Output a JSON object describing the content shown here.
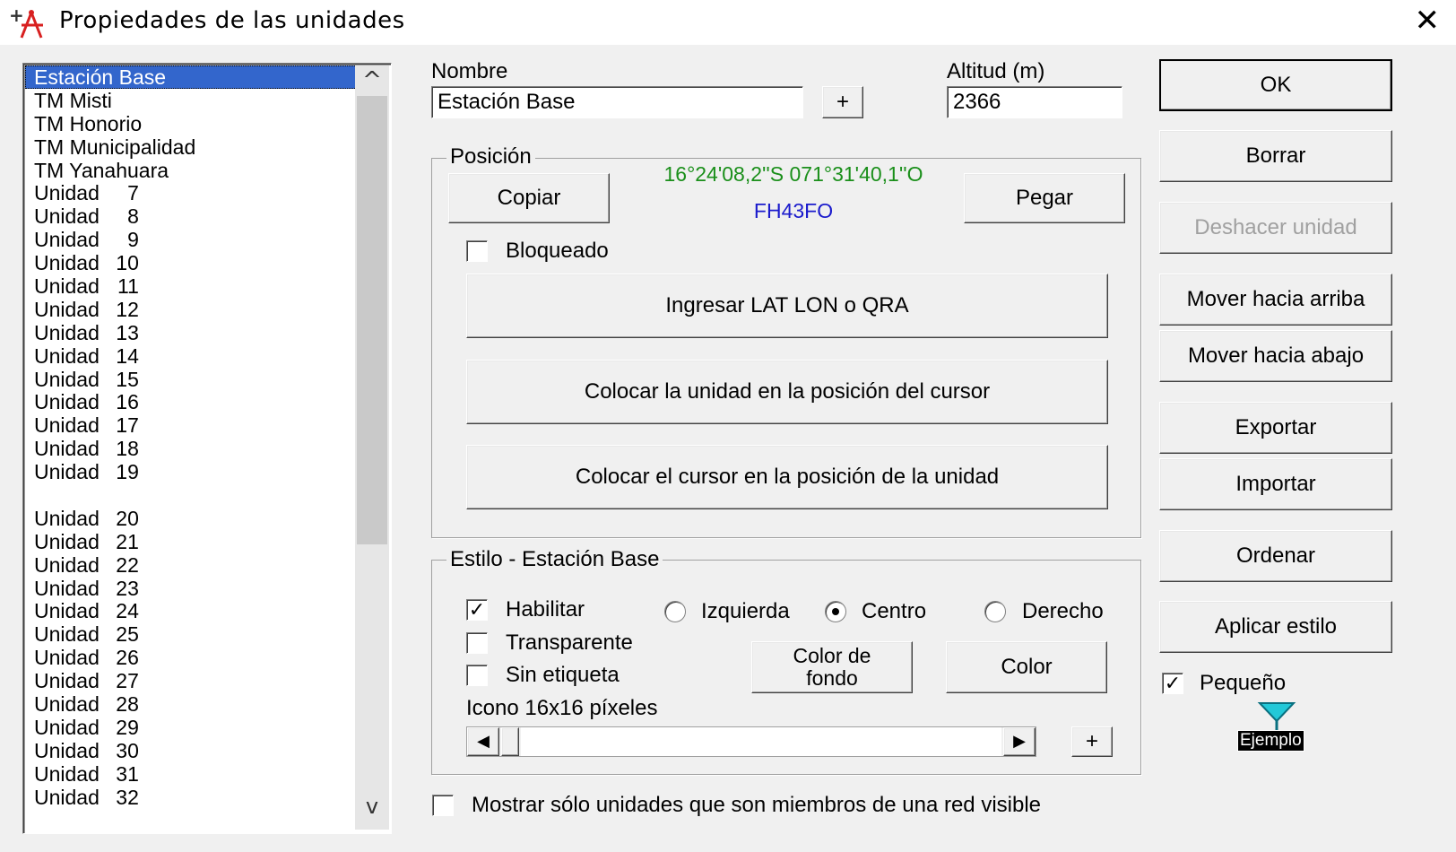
{
  "window": {
    "title": "Propiedades de las unidades",
    "close_glyph": "✕",
    "icon": "unit-properties-icon"
  },
  "units_list": {
    "selected_index": 0,
    "items": [
      {
        "name": "Estación Base",
        "num": ""
      },
      {
        "name": "TM Misti",
        "num": ""
      },
      {
        "name": "TM Honorio",
        "num": ""
      },
      {
        "name": "TM Municipalidad",
        "num": ""
      },
      {
        "name": "TM Yanahuara",
        "num": ""
      },
      {
        "name": "Unidad",
        "num": "7"
      },
      {
        "name": "Unidad",
        "num": "8"
      },
      {
        "name": "Unidad",
        "num": "9"
      },
      {
        "name": "Unidad",
        "num": "10"
      },
      {
        "name": "Unidad",
        "num": "11"
      },
      {
        "name": "Unidad",
        "num": "12"
      },
      {
        "name": "Unidad",
        "num": "13"
      },
      {
        "name": "Unidad",
        "num": "14"
      },
      {
        "name": "Unidad",
        "num": "15"
      },
      {
        "name": "Unidad",
        "num": "16"
      },
      {
        "name": "Unidad",
        "num": "17"
      },
      {
        "name": "Unidad",
        "num": "18"
      },
      {
        "name": "Unidad",
        "num": "19"
      },
      {
        "name": "",
        "num": ""
      },
      {
        "name": "Unidad",
        "num": "20"
      },
      {
        "name": "Unidad",
        "num": "21"
      },
      {
        "name": "Unidad",
        "num": "22"
      },
      {
        "name": "Unidad",
        "num": "23"
      },
      {
        "name": "Unidad",
        "num": "24"
      },
      {
        "name": "Unidad",
        "num": "25"
      },
      {
        "name": "Unidad",
        "num": "26"
      },
      {
        "name": "Unidad",
        "num": "27"
      },
      {
        "name": "Unidad",
        "num": "28"
      },
      {
        "name": "Unidad",
        "num": "29"
      },
      {
        "name": "Unidad",
        "num": "30"
      },
      {
        "name": "Unidad",
        "num": "31"
      },
      {
        "name": "Unidad",
        "num": "32"
      }
    ]
  },
  "name_field": {
    "label": "Nombre",
    "value": "Estación Base",
    "plus_label": "+"
  },
  "altitude_field": {
    "label": "Altitud (m)",
    "value": "2366"
  },
  "position": {
    "title": "Posición",
    "copy_label": "Copiar",
    "paste_label": "Pegar",
    "coords": "16°24'08,2''S 071°31'40,1''O",
    "qra": "FH43FO",
    "coords_color": "#1a8f1a",
    "qra_color": "#1a1acc",
    "locked_label": "Bloqueado",
    "locked": false,
    "enter_latlon_label": "Ingresar LAT LON o QRA",
    "place_unit_label": "Colocar la unidad en la posición del cursor",
    "place_cursor_label": "Colocar el cursor en la posición de la unidad"
  },
  "style": {
    "title": "Estilo - Estación Base",
    "enable_label": "Habilitar",
    "enable_checked": true,
    "transparent_label": "Transparente",
    "no_label_label": "Sin etiqueta",
    "align_left_label": "Izquierda",
    "align_center_label": "Centro",
    "align_right_label": "Derecho",
    "selected_align": "center",
    "bg_color_label": "Color de\nfondo",
    "color_label": "Color",
    "icon_size_label": "Icono 16x16 píxeles",
    "plus_label": "+",
    "slider_value": 0
  },
  "show_members_label": "Mostrar sólo unidades que son miembros de una red visible",
  "side_buttons": {
    "ok": "OK",
    "delete": "Borrar",
    "undo": "Deshacer unidad",
    "move_up": "Mover hacia arriba",
    "move_down": "Mover hacia abajo",
    "export": "Exportar",
    "import": "Importar",
    "sort": "Ordenar",
    "apply_style": "Aplicar estilo"
  },
  "small": {
    "label": "Pequeño",
    "checked": true,
    "example_label": "Ejemplo",
    "marker_color": "#22c8d8"
  },
  "glyphs": {
    "check": "✓",
    "up": "^",
    "down": "v",
    "left": "◀",
    "right": "▶"
  }
}
